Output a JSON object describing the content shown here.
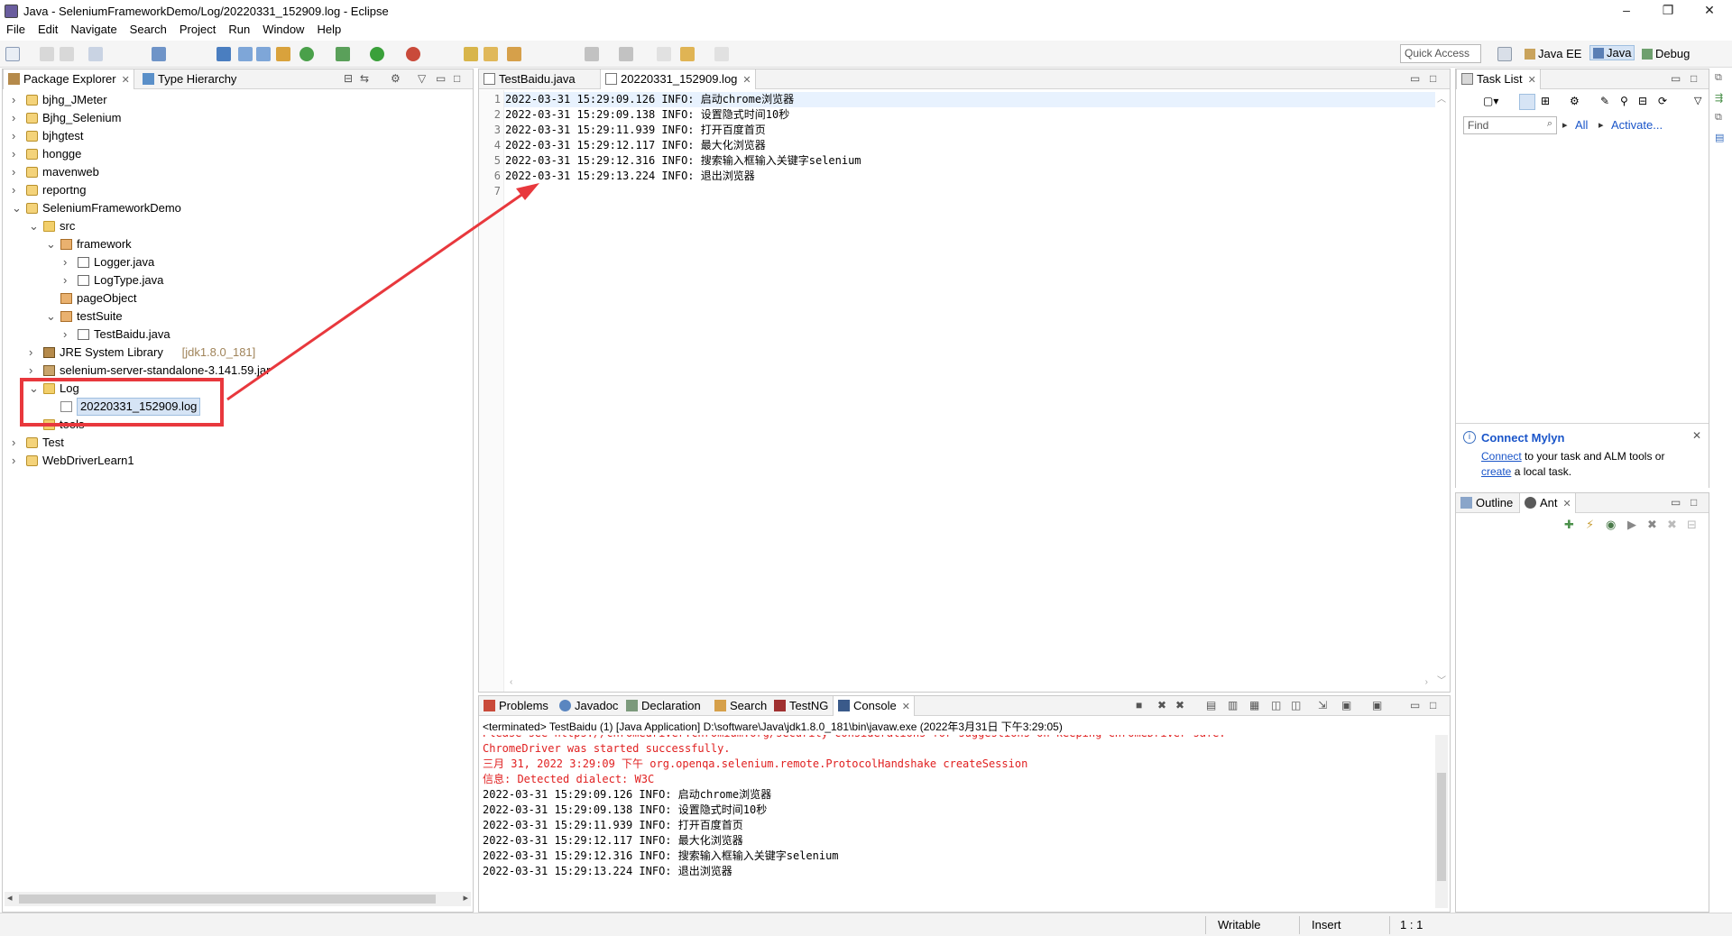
{
  "window": {
    "title": "Java - SeleniumFrameworkDemo/Log/20220331_152909.log - Eclipse",
    "controls": {
      "minimize": "–",
      "maximize": "❐",
      "close": "✕"
    }
  },
  "menu": [
    "File",
    "Edit",
    "Navigate",
    "Search",
    "Project",
    "Run",
    "Window",
    "Help"
  ],
  "toolbar": {
    "quick_access_placeholder": "Quick Access",
    "perspectives": [
      "Java EE",
      "Java",
      "Debug"
    ],
    "active_perspective": "Java"
  },
  "package_explorer": {
    "tabs": [
      "Package Explorer",
      "Type Hierarchy"
    ],
    "tree": [
      {
        "label": "bjhg_JMeter",
        "kind": "project",
        "depth": 0,
        "expanded": false
      },
      {
        "label": "Bjhg_Selenium",
        "kind": "project",
        "depth": 0,
        "expanded": false
      },
      {
        "label": "bjhgtest",
        "kind": "project",
        "depth": 0,
        "expanded": false
      },
      {
        "label": "hongge",
        "kind": "project",
        "depth": 0,
        "expanded": false
      },
      {
        "label": "mavenweb",
        "kind": "project",
        "depth": 0,
        "expanded": false
      },
      {
        "label": "reportng",
        "kind": "project",
        "depth": 0,
        "expanded": false
      },
      {
        "label": "SeleniumFrameworkDemo",
        "kind": "project",
        "depth": 0,
        "expanded": true
      },
      {
        "label": "src",
        "kind": "folder",
        "depth": 1,
        "expanded": true
      },
      {
        "label": "framework",
        "kind": "package",
        "depth": 2,
        "expanded": true
      },
      {
        "label": "Logger.java",
        "kind": "java",
        "depth": 3,
        "expanded": false
      },
      {
        "label": "LogType.java",
        "kind": "java",
        "depth": 3,
        "expanded": false
      },
      {
        "label": "pageObject",
        "kind": "package",
        "depth": 2,
        "expanded": null
      },
      {
        "label": "testSuite",
        "kind": "package",
        "depth": 2,
        "expanded": true
      },
      {
        "label": "TestBaidu.java",
        "kind": "java",
        "depth": 3,
        "expanded": false
      },
      {
        "label": "JRE System Library",
        "suffix": "[jdk1.8.0_181]",
        "kind": "lib",
        "depth": 1,
        "expanded": false
      },
      {
        "label": "selenium-server-standalone-3.141.59.jar",
        "kind": "jar",
        "depth": 1,
        "expanded": false
      },
      {
        "label": "Log",
        "kind": "folder",
        "depth": 1,
        "expanded": true
      },
      {
        "label": "20220331_152909.log",
        "kind": "file",
        "depth": 2,
        "expanded": null,
        "selected": true
      },
      {
        "label": "tools",
        "kind": "folder",
        "depth": 1,
        "expanded": null
      },
      {
        "label": "Test",
        "kind": "project",
        "depth": 0,
        "expanded": false
      },
      {
        "label": "WebDriverLearn1",
        "kind": "project",
        "depth": 0,
        "expanded": false
      }
    ]
  },
  "editor": {
    "tabs": [
      "TestBaidu.java",
      "20220331_152909.log"
    ],
    "active_tab": "20220331_152909.log",
    "lines": [
      {
        "num": "1",
        "text": "2022-03-31 15:29:09.126 INFO: 启动chrome浏览器"
      },
      {
        "num": "2",
        "text": "2022-03-31 15:29:09.138 INFO: 设置隐式时间10秒"
      },
      {
        "num": "3",
        "text": "2022-03-31 15:29:11.939 INFO: 打开百度首页"
      },
      {
        "num": "4",
        "text": "2022-03-31 15:29:12.117 INFO: 最大化浏览器"
      },
      {
        "num": "5",
        "text": "2022-03-31 15:29:12.316 INFO: 搜索输入框输入关键字selenium"
      },
      {
        "num": "6",
        "text": "2022-03-31 15:29:13.224 INFO: 退出浏览器"
      },
      {
        "num": "7",
        "text": ""
      }
    ]
  },
  "task_list": {
    "tab": "Task List",
    "find_placeholder": "Find",
    "all_label": "All",
    "activate_label": "Activate..."
  },
  "mylyn": {
    "title": "Connect Mylyn",
    "connect_link": "Connect",
    "text1": " to your task and ALM tools or",
    "create_link": "create",
    "text2": " a local task."
  },
  "outline": {
    "tabs": [
      "Outline",
      "Ant"
    ]
  },
  "console": {
    "tabs": [
      "Problems",
      "Javadoc",
      "Declaration",
      "Search",
      "TestNG",
      "Console"
    ],
    "active_tab": "Console",
    "header": "<terminated> TestBaidu (1) [Java Application] D:\\software\\Java\\jdk1.8.0_181\\bin\\javaw.exe (2022年3月31日 下午3:29:05)",
    "lines": [
      {
        "text": "Please see https://chromedriver.chromium.org/security-considerations for suggestions on keeping ChromeDriver safe.",
        "color": "red"
      },
      {
        "text": "ChromeDriver was started successfully.",
        "color": "red"
      },
      {
        "text": "三月 31, 2022 3:29:09 下午 org.openqa.selenium.remote.ProtocolHandshake createSession",
        "color": "red"
      },
      {
        "text": "信息: Detected dialect: W3C",
        "color": "red"
      },
      {
        "text": "2022-03-31 15:29:09.126 INFO: 启动chrome浏览器",
        "color": "black"
      },
      {
        "text": "2022-03-31 15:29:09.138 INFO: 设置隐式时间10秒",
        "color": "black"
      },
      {
        "text": "2022-03-31 15:29:11.939 INFO: 打开百度首页",
        "color": "black"
      },
      {
        "text": "2022-03-31 15:29:12.117 INFO: 最大化浏览器",
        "color": "black"
      },
      {
        "text": "2022-03-31 15:29:12.316 INFO: 搜索输入框输入关键字selenium",
        "color": "black"
      },
      {
        "text": "2022-03-31 15:29:13.224 INFO: 退出浏览器",
        "color": "black"
      }
    ]
  },
  "status_bar": {
    "writable": "Writable",
    "insert": "Insert",
    "position": "1 : 1"
  },
  "colors": {
    "annotation_red": "#e8383d",
    "console_error": "#e02020",
    "link": "#1a55c9",
    "selection": "#d6e4f5"
  }
}
